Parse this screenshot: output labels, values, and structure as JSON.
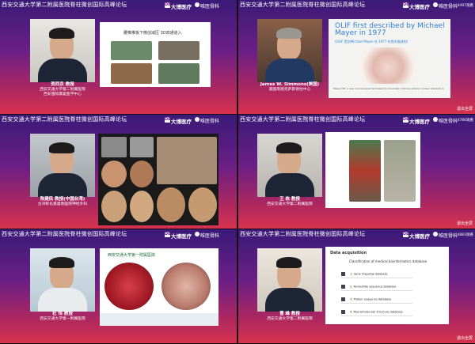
{
  "header": {
    "title": "西安交通大学第二附属医院脊柱微创国际高峰论坛",
    "logo_brand": "大博医疗",
    "logo_brand_mark": "DB",
    "logo_partner": "唯医骨科",
    "exit_label": "退出全屏"
  },
  "panels": [
    {
      "views": "",
      "speaker_name": "贺西京 教授",
      "speaker_affil_1": "西安交通大学第二附属医院",
      "speaker_affil_2": "西安国际康复医学中心",
      "slide_title": "腰椎椎板下微创减压 3D双通道入",
      "slide_title_b": ""
    },
    {
      "views": "4497观看",
      "speaker_name": "James W. Simmons(美国)",
      "speaker_affil_1": "美国南德克萨斯脊柱中心",
      "speaker_affil_2": "",
      "slide_title": "OLIF first described by Michael Mayer in 1977",
      "slide_title_b": "(OLIF 是由Michael Mayer 在 1977 年首先描述的)",
      "slide_foot": "Mayer HM. A new microsurgical technique for minimally invasive anterior lumbar interbody fusion. Spine 1997"
    },
    {
      "views": "",
      "speaker_name": "陈建民 教授(中国台湾)",
      "speaker_affil_1": "台湾彰化基督教医院神经外科",
      "speaker_affil_2": "",
      "slide_title": "",
      "slide_title_b": ""
    },
    {
      "views": "4786观看",
      "speaker_name": "王 栋 教授",
      "speaker_affil_1": "西安交通大学第二附属医院",
      "speaker_affil_2": "",
      "slide_title": "",
      "slide_title_b": ""
    },
    {
      "views": "",
      "speaker_name": "杜 恒 教授",
      "speaker_affil_1": "西安交通大学第一附属医院",
      "speaker_affil_2": "",
      "slide_title": "西安交通大学第一附属医院",
      "slide_title_b": ""
    },
    {
      "views": "4883观看",
      "speaker_name": "曹 峰 教授",
      "speaker_affil_1": "西安交通大学第二附属医院",
      "speaker_affil_2": "",
      "slide_title": "Data acquisition",
      "slide_title_b": "Classification of medical bioinformatics database",
      "list": [
        "1. Gene mapping database",
        "2. Nucleotide sequence database",
        "3. Protein sequence database",
        "4. Macromolecular structure database"
      ]
    }
  ]
}
